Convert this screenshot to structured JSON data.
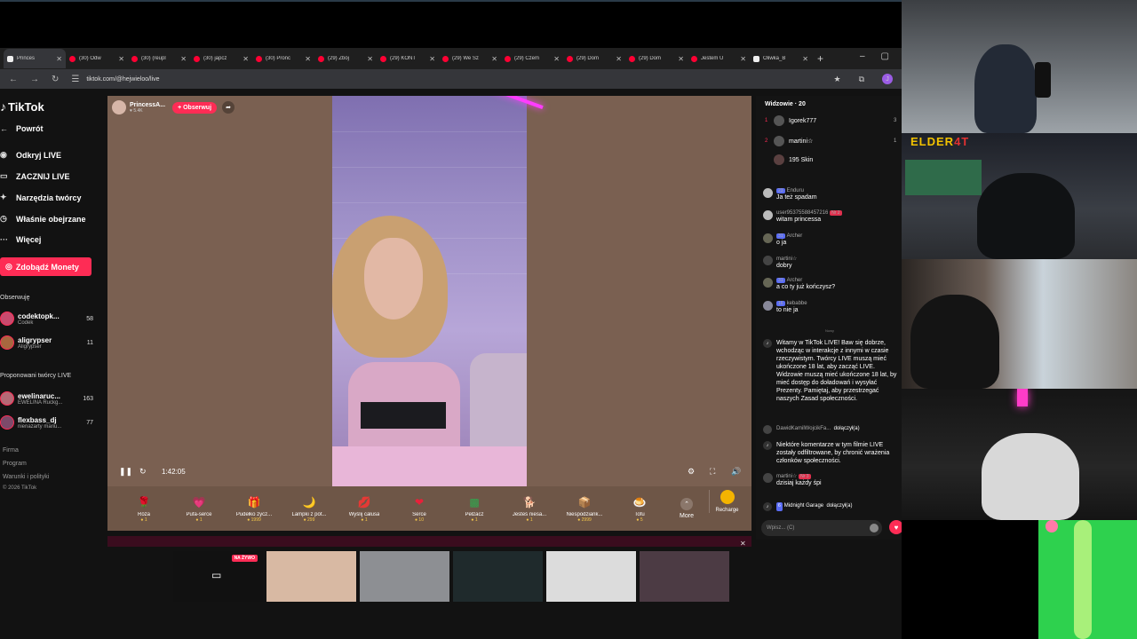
{
  "browser": {
    "tabs": [
      {
        "title": "Princes",
        "kind": "tt",
        "active": true
      },
      {
        "title": "(30) Odw",
        "kind": "yt"
      },
      {
        "title": "(30) (reupl",
        "kind": "yt"
      },
      {
        "title": "(30) japcz",
        "kind": "yt"
      },
      {
        "title": "(30) Pronc",
        "kind": "yt"
      },
      {
        "title": "(29) Zbój",
        "kind": "yt"
      },
      {
        "title": "(29) KONT",
        "kind": "yt"
      },
      {
        "title": "(29) We Sz",
        "kind": "yt"
      },
      {
        "title": "(29) Czem",
        "kind": "yt"
      },
      {
        "title": "(29) Dom",
        "kind": "yt"
      },
      {
        "title": "(29) Dom",
        "kind": "yt"
      },
      {
        "title": "Jestem U",
        "kind": "yt"
      },
      {
        "title": "Oliwka_B",
        "kind": "tt"
      }
    ],
    "url": "tiktok.com/@hejwieloo/live",
    "profile_letter": "J"
  },
  "sidebar": {
    "logo": "TikTok",
    "nav": [
      {
        "label": "Powrót",
        "icon": "back-arrow-icon"
      },
      {
        "label": "Odkryj LIVE",
        "icon": "live-icon"
      },
      {
        "label": "ZACZNIJ LIVE",
        "icon": "camera-icon"
      },
      {
        "label": "Narzędzia twórcy",
        "icon": "tools-icon"
      },
      {
        "label": "Właśnie obejrzane",
        "icon": "history-icon"
      },
      {
        "label": "Więcej",
        "icon": "more-icon"
      }
    ],
    "coins_button": "Zdobądź Monety",
    "following_label": "Obserwuję",
    "following": [
      {
        "name": "codektopk...",
        "sub": "Codek",
        "count": "58"
      },
      {
        "name": "aligrypser",
        "sub": "Aligrypser",
        "count": "11"
      }
    ],
    "suggested_label": "Proponowani twórcy LIVE",
    "suggested": [
      {
        "name": "ewelinaruc...",
        "sub": "EWELINA Ruckg...",
        "count": "163"
      },
      {
        "name": "flexbass_dj",
        "sub": "nienazarty mariu...",
        "count": "77"
      }
    ],
    "footer": [
      "Firma",
      "Program",
      "Warunki i polityki",
      "© 2026 TikTok"
    ]
  },
  "stream": {
    "host_name": "PrincessA...",
    "host_likes": "5.4K",
    "follow_label": "+ Obserwuj",
    "time": "1:42:05"
  },
  "gifts": [
    {
      "name": "Róża",
      "price": "1",
      "icon": "🌹",
      "color": "#d63447"
    },
    {
      "name": "Pufa-serce",
      "price": "1",
      "icon": "💗",
      "color": "#f2a7c3"
    },
    {
      "name": "Pudełko życz...",
      "price": "1999",
      "icon": "🎁",
      "color": "#c8a415"
    },
    {
      "name": "Lampki z pót...",
      "price": "299",
      "icon": "🌙",
      "color": "#e8c24a"
    },
    {
      "name": "Wyślij całusa",
      "price": "1",
      "icon": "💋",
      "color": "#d62a3a"
    },
    {
      "name": "Serce",
      "price": "10",
      "icon": "❤",
      "color": "#e8203a"
    },
    {
      "name": "Pełzacz",
      "price": "1",
      "icon": "▩",
      "color": "#2fa84f"
    },
    {
      "name": "Jesteś niesa...",
      "price": "1",
      "icon": "🐕",
      "color": "#d9b27a"
    },
    {
      "name": "Niespodziank...",
      "price": "2999",
      "icon": "📦",
      "color": "#6aa0c8"
    },
    {
      "name": "Tofu",
      "price": "5",
      "icon": "🍮",
      "color": "#f3a03a"
    }
  ],
  "gifts_more": "More",
  "recharge": "Recharge",
  "chat": {
    "viewers_label": "Widzowie · 20",
    "top_viewers": [
      {
        "rank": "1",
        "name": "Igorek777",
        "score": "3"
      },
      {
        "rank": "2",
        "name": "martini☆",
        "score": "1"
      },
      {
        "rank": "",
        "name": "195 Skin",
        "score": ""
      }
    ],
    "messages": [
      {
        "user": "Enduru",
        "badge": "23",
        "badge_color": "blue",
        "text": "Ja też spadam"
      },
      {
        "user": "user953755884572​16",
        "badge": "Nr 2",
        "badge_color": "red",
        "text": "witam princessa"
      },
      {
        "user": "Archer",
        "badge": "31",
        "badge_color": "blue",
        "text": "o ja"
      },
      {
        "user": "martini☆",
        "badge": "",
        "badge_color": "",
        "text": "dobry"
      },
      {
        "user": "Archer",
        "badge": "31",
        "badge_color": "blue",
        "text": "a co ty już kończysz?"
      },
      {
        "user": "kebabbe",
        "badge": "16",
        "badge_color": "blue",
        "text": "to nie ja"
      }
    ],
    "new_label": "Nowy",
    "system1": "Witamy w TikTok LIVE! Baw się dobrze, wchodząc w interakcje z innymi w czasie rzeczywistym. Twórcy LIVE muszą mieć ukończone 18 lat, aby zacząć LIVE. Widzowie muszą mieć ukończone 18 lat, by mieć dostęp do doładowań i wysyłać Prezenty. Pamiętaj, aby przestrzegać naszych Zasad społeczności.",
    "joined1_user": "DawidKamilWojcikFa...",
    "joined_text": "dołączył(a)",
    "system2": "Niektóre komentarze w tym filmie LIVE zostały odfiltrowane, by chronić wrażenia członków społeczności.",
    "last_user": "martini☆",
    "last_badge": "Nr 3",
    "last_text": "dzisiaj każdy śpi",
    "joined2_user": "Midnight Garage",
    "joined2_badge": "6",
    "input_placeholder": "Wpisz... (C)"
  },
  "thumbs_live_label": "NA ŻYWO",
  "cam_overlay": {
    "elder": "ELDER",
    "elder_accent": "4T"
  }
}
